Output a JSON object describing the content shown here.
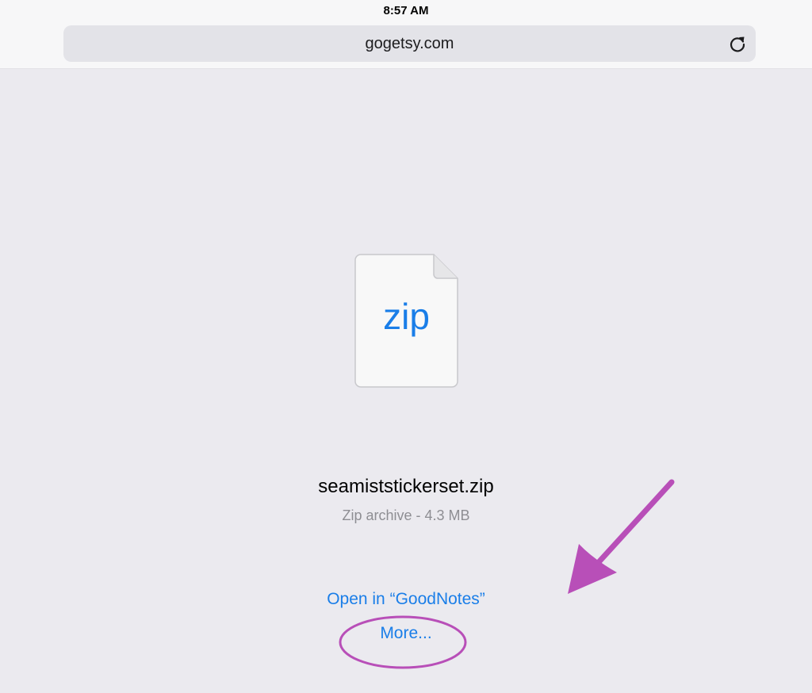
{
  "status_bar": {
    "time": "8:57 AM"
  },
  "nav_bar": {
    "address": "gogetsy.com",
    "reload_icon": "reload-icon"
  },
  "file": {
    "icon": "zip-file-icon",
    "extension": "zip",
    "name": "seamiststickerset.zip",
    "meta": "Zip archive - 4.3 MB"
  },
  "actions": {
    "open_in": "Open in “GoodNotes”",
    "more": "More..."
  },
  "annotation": {
    "color": "#b84fb8"
  },
  "colors": {
    "accent": "#1a7ee8",
    "background": "#ebeaef",
    "secondary_text": "#8e8e93"
  }
}
